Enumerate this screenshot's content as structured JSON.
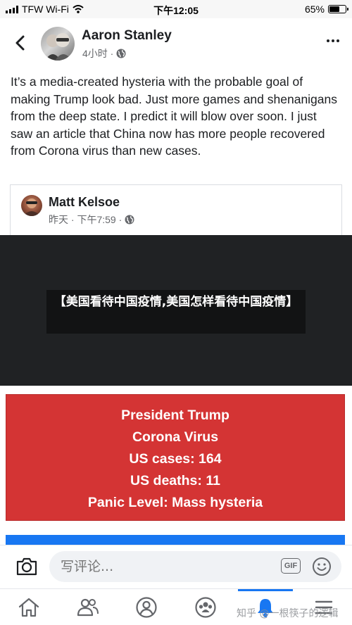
{
  "status_bar": {
    "carrier": "TFW Wi-Fi",
    "time": "下午12:05",
    "battery_percent": "65%",
    "battery_level": 0.65
  },
  "post": {
    "author": "Aaron Stanley",
    "meta": "4小时 ·",
    "text": "It’s a media-created hysteria with the probable goal of making Trump look bad. Just more games and shenanigans from the deep state. I predict it will blow over soon. I just saw an article that China now has more people recovered from Corona virus than new cases."
  },
  "shared": {
    "author": "Matt Kelsoe",
    "meta": "昨天 · 下午7:59 ·"
  },
  "banner": {
    "title": "【美国看待中国疫情,美国怎样看待中国疫情】"
  },
  "image": {
    "lines": [
      "President Trump",
      "Corona Virus",
      "US cases: 164",
      "US deaths: 11",
      "Panic Level: Mass hysteria"
    ]
  },
  "comment": {
    "placeholder": "写评论...",
    "gif_label": "GIF"
  },
  "tabs": [
    "home-icon",
    "friends-icon",
    "profile-icon",
    "groups-icon",
    "notifications-icon"
  ],
  "watermark": "知乎 @一根筷子的逻辑",
  "colors": {
    "accent": "#1877f2",
    "red_image": "#d43434",
    "dark_band": "#202224"
  }
}
